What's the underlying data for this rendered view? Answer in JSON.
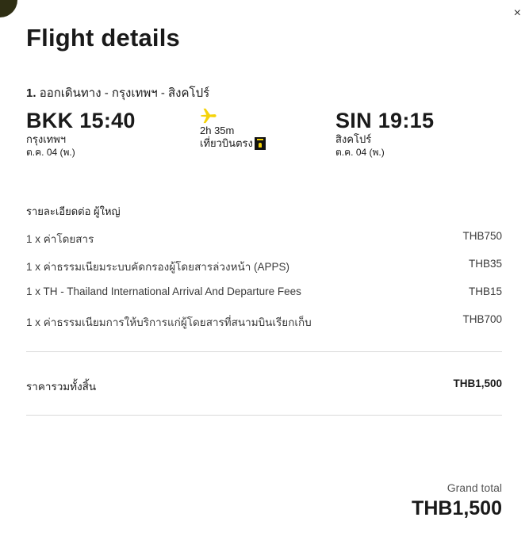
{
  "title": "Flight details",
  "close_label": "×",
  "route": {
    "index": "1.",
    "text": "ออกเดินทาง - กรุงเทพฯ - สิงคโปร์"
  },
  "departure": {
    "code_time": "BKK 15:40",
    "city": "กรุงเทพฯ",
    "date": "ต.ค. 04 (พ.)"
  },
  "middle": {
    "icon": "plane-icon",
    "duration": "2h 35m",
    "type": "เที่ยวบินตรง",
    "badge_icon": "seat-badge-icon",
    "accent": "#f5d30a"
  },
  "arrival": {
    "code_time": "SIN 19:15",
    "city": "สิงคโปร์",
    "date": "ต.ค. 04 (พ.)"
  },
  "breakdown": {
    "title": "รายละเอียดต่อ ผู้ใหญ่",
    "items": [
      {
        "label": "1 x ค่าโดยสาร",
        "value": "THB750"
      },
      {
        "label": "1 x ค่าธรรมเนียมระบบคัดกรองผู้โดยสารล่วงหน้า (APPS)",
        "value": "THB35"
      },
      {
        "label": "1 x TH - Thailand International Arrival And Departure Fees",
        "value": "THB15"
      },
      {
        "label": "1 x ค่าธรรมเนียมการให้บริการแก่ผู้โดยสารที่สนามบินเรียกเก็บ",
        "value": "THB700"
      }
    ]
  },
  "total": {
    "label": "ราคารวมทั้งสิ้น",
    "value": "THB1,500"
  },
  "grand_total": {
    "label": "Grand total",
    "value": "THB1,500"
  }
}
